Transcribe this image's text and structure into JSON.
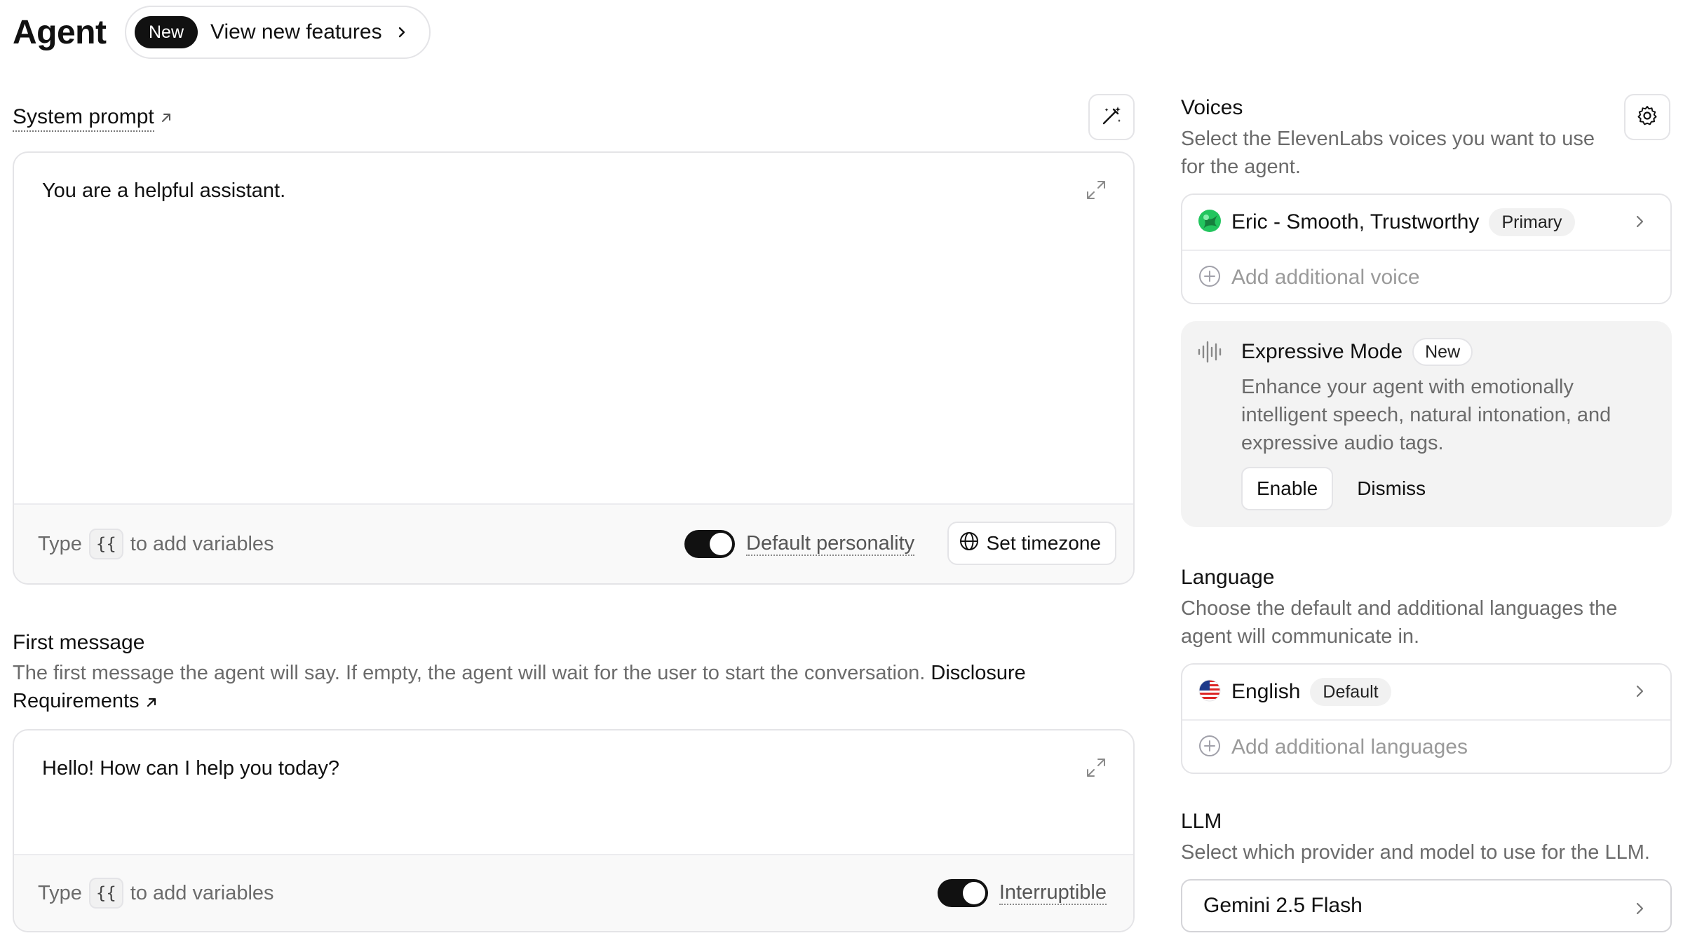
{
  "header": {
    "title": "Agent",
    "new_badge": "New",
    "features_link": "View new features"
  },
  "system_prompt": {
    "label": "System prompt",
    "value": "You are a helpful assistant.",
    "hint_type": "Type",
    "hint_key": "{{",
    "hint_rest": "to add variables",
    "personality_label": "Default personality",
    "personality_on": true,
    "timezone_button": "Set timezone"
  },
  "first_message": {
    "label": "First message",
    "description": "The first message the agent will say. If empty, the agent will wait for the user to start the conversation.",
    "disclosure_link": "Disclosure Requirements",
    "value": "Hello! How can I help you today?",
    "hint_type": "Type",
    "hint_key": "{{",
    "hint_rest": "to add variables",
    "interruptible_label": "Interruptible",
    "interruptible_on": true
  },
  "voices": {
    "title": "Voices",
    "description": "Select the ElevenLabs voices you want to use for the agent.",
    "primary_voice": "Eric - Smooth, Trustworthy",
    "primary_badge": "Primary",
    "add_voice": "Add additional voice"
  },
  "expressive": {
    "title": "Expressive Mode",
    "badge": "New",
    "description": "Enhance your agent with emotionally intelligent speech, natural intonation, and expressive audio tags.",
    "enable": "Enable",
    "dismiss": "Dismiss"
  },
  "language": {
    "title": "Language",
    "description": "Choose the default and additional languages the agent will communicate in.",
    "default_language": "English",
    "default_badge": "Default",
    "add_language": "Add additional languages"
  },
  "llm": {
    "title": "LLM",
    "description": "Select which provider and model to use for the LLM.",
    "selected": "Gemini 2.5 Flash"
  },
  "icons": [
    "chevron-right-icon",
    "external-link-icon",
    "magic-wand-icon",
    "expand-icon",
    "globe-icon",
    "gear-icon",
    "plus-circle-icon",
    "waveform-icon",
    "us-flag-icon",
    "voice-avatar-icon"
  ],
  "colors": {
    "accent": "#111111",
    "muted_text": "#6b6b6b",
    "border": "#e4e4e7",
    "panel": "#f3f3f3"
  }
}
